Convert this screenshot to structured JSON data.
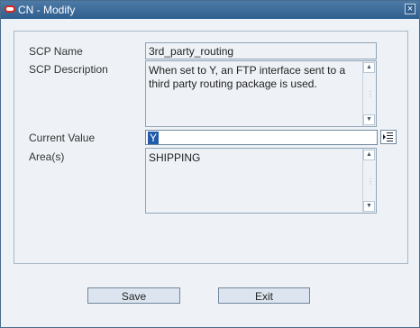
{
  "window": {
    "title": "CN - Modify"
  },
  "form": {
    "scp_name": {
      "label": "SCP Name",
      "value": "3rd_party_routing"
    },
    "scp_description": {
      "label": "SCP Description",
      "value": "When set to Y, an FTP interface sent to a third party routing package is used."
    },
    "current_value": {
      "label": "Current Value",
      "value": "Y"
    },
    "areas": {
      "label": "Area(s)",
      "value": "SHIPPING"
    }
  },
  "actions": {
    "save": "Save",
    "exit": "Exit"
  },
  "icons": {
    "app": "oracle-logo-icon",
    "close": "close-icon",
    "lov": "list-of-values-icon"
  }
}
